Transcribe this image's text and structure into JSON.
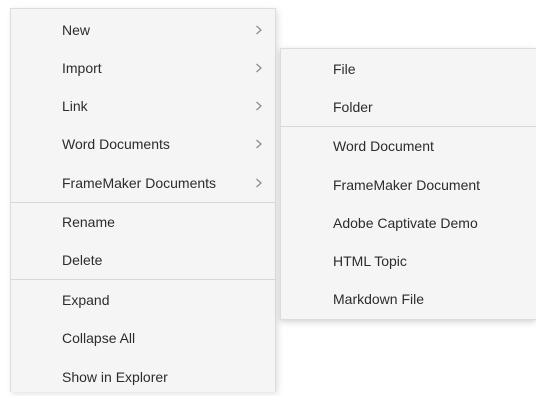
{
  "main_menu": {
    "items": [
      {
        "label": "New"
      },
      {
        "label": "Import"
      },
      {
        "label": "Link"
      },
      {
        "label": "Word Documents"
      },
      {
        "label": "FrameMaker Documents"
      },
      {
        "label": "Rename"
      },
      {
        "label": "Delete"
      },
      {
        "label": "Expand"
      },
      {
        "label": "Collapse All"
      },
      {
        "label": "Show in Explorer"
      }
    ]
  },
  "submenu": {
    "items": [
      {
        "label": "File"
      },
      {
        "label": "Folder"
      },
      {
        "label": "Word Document"
      },
      {
        "label": "FrameMaker Document"
      },
      {
        "label": "Adobe Captivate Demo"
      },
      {
        "label": "HTML Topic"
      },
      {
        "label": "Markdown File"
      }
    ]
  },
  "chevron_icon": "chevron-right-icon"
}
